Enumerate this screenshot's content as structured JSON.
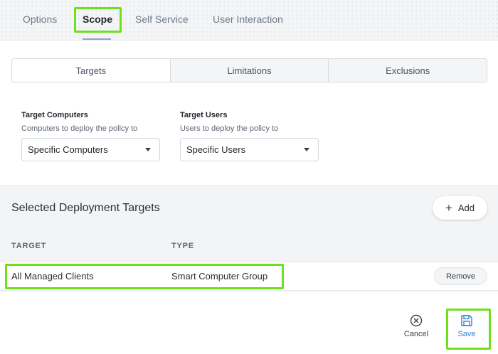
{
  "tabs": [
    {
      "label": "Options"
    },
    {
      "label": "Scope"
    },
    {
      "label": "Self Service"
    },
    {
      "label": "User Interaction"
    }
  ],
  "segments": [
    "Targets",
    "Limitations",
    "Exclusions"
  ],
  "target_computers": {
    "label": "Target Computers",
    "description": "Computers to deploy the policy to",
    "value": "Specific Computers"
  },
  "target_users": {
    "label": "Target Users",
    "description": "Users to deploy the policy to",
    "value": "Specific Users"
  },
  "deployment": {
    "title": "Selected Deployment Targets",
    "add_label": "Add",
    "columns": [
      "TARGET",
      "TYPE"
    ],
    "rows": [
      {
        "target": "All Managed Clients",
        "type": "Smart Computer Group",
        "remove_label": "Remove"
      }
    ]
  },
  "footer": {
    "cancel_label": "Cancel",
    "save_label": "Save"
  },
  "colors": {
    "highlight": "#6ee01e",
    "save": "#2f7fd1"
  },
  "icons": {
    "add": "plus-icon",
    "cancel": "cancel-circle-icon",
    "save": "save-floppy-icon",
    "dropdown": "caret-down-icon"
  }
}
